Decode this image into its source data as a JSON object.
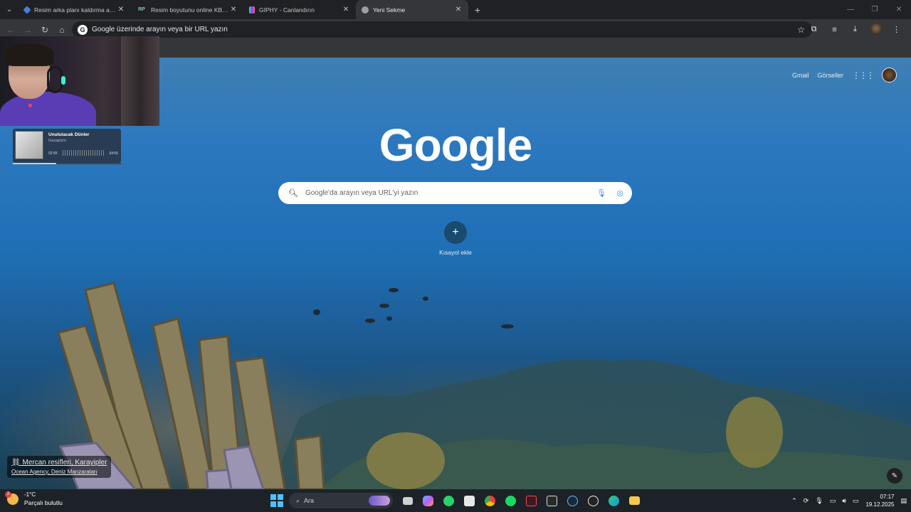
{
  "browser": {
    "tabs": [
      {
        "label": "Resim arka planı kaldırma aracı",
        "favicon": "tag-icon",
        "active": false
      },
      {
        "label": "Resim boyutunu online KB/MB",
        "favicon": "rp-icon",
        "favicon_text": "RP",
        "active": false
      },
      {
        "label": "GIPHY - Canlandırın",
        "favicon": "giphy-icon",
        "active": false
      },
      {
        "label": "Yeni Sekme",
        "favicon": "chrome-icon",
        "active": true
      }
    ],
    "address_placeholder": "Google üzerinde arayın veya bir URL yazın",
    "omnibox_badge": "G"
  },
  "newtab": {
    "links": [
      "Gmail",
      "Görseller"
    ],
    "logo": "Google",
    "search_placeholder": "Google'da arayın veya URL'yi yazın",
    "shortcut_label": "Kısayol ekle",
    "attribution_title": "Mercan resifleri, Karayipler",
    "attribution_credit": "Ocean Agency, Deniz Manzaraları"
  },
  "overlay": {
    "song_title": "Unutulacak Dünler",
    "song_artist": "Gazapizm",
    "elapsed": "02:55",
    "duration": "04:55",
    "progress": 0.4
  },
  "taskbar": {
    "weather_badge": "2",
    "temperature": "-1°C",
    "weather_desc": "Parçalı bulutlu",
    "search_label": "Ara",
    "time": "07:17",
    "date": "19.12.2025"
  },
  "colors": {
    "accent": "#4cc2ff",
    "chrome_bg": "#202124",
    "toolbar_bg": "#35363a",
    "taskbar_bg": "#1c2228"
  }
}
